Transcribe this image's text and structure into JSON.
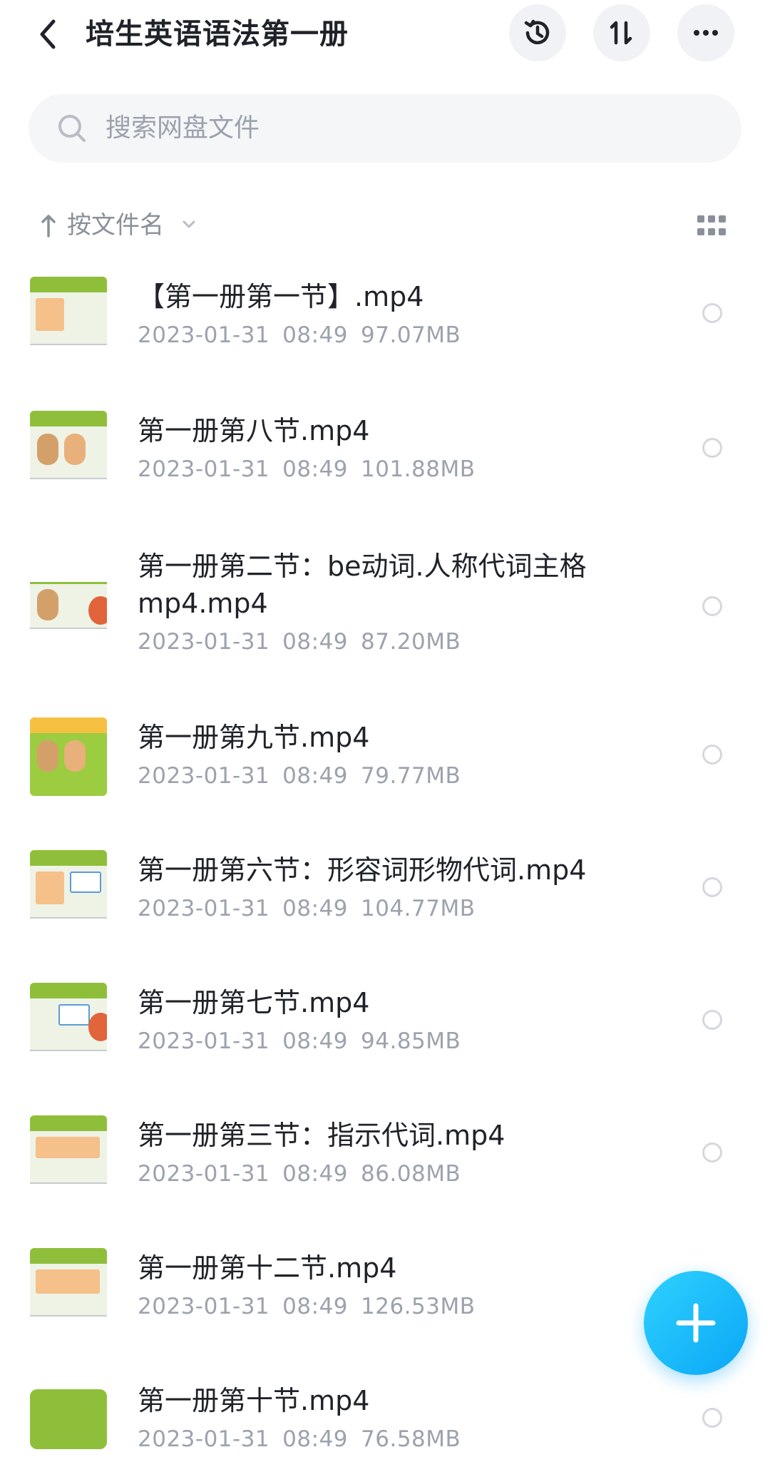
{
  "header": {
    "title": "培生英语语法第一册",
    "back_icon": "chevron-left-icon",
    "actions": [
      "history-icon",
      "sort-order-icon",
      "more-icon"
    ]
  },
  "search": {
    "placeholder": "搜索网盘文件"
  },
  "sort": {
    "label": "按文件名",
    "direction_icon": "arrow-up-icon",
    "view_icon": "grid-view-icon"
  },
  "files": [
    {
      "name": "【第一册第一节】.mp4",
      "name_line2": "",
      "date": "2023-01-31",
      "time": "08:49",
      "size": "97.07MB"
    },
    {
      "name": "第一册第八节.mp4",
      "name_line2": "",
      "date": "2023-01-31",
      "time": "08:49",
      "size": "101.88MB"
    },
    {
      "name": "第一册第二节：be动词.人称代词主格",
      "name_line2": "mp4.mp4",
      "date": "2023-01-31",
      "time": "08:49",
      "size": "87.20MB"
    },
    {
      "name": "第一册第九节.mp4",
      "name_line2": "",
      "date": "2023-01-31",
      "time": "08:49",
      "size": "79.77MB"
    },
    {
      "name": "第一册第六节：形容词形物代词.mp4",
      "name_line2": "",
      "date": "2023-01-31",
      "time": "08:49",
      "size": "104.77MB"
    },
    {
      "name": "第一册第七节.mp4",
      "name_line2": "",
      "date": "2023-01-31",
      "time": "08:49",
      "size": "94.85MB"
    },
    {
      "name": "第一册第三节：指示代词.mp4",
      "name_line2": "",
      "date": "2023-01-31",
      "time": "08:49",
      "size": "86.08MB"
    },
    {
      "name": "第一册第十二节.mp4",
      "name_line2": "",
      "date": "2023-01-31",
      "time": "08:49",
      "size": "126.53MB"
    },
    {
      "name": "第一册第十节.mp4",
      "name_line2": "",
      "date": "2023-01-31",
      "time": "08:49",
      "size": "76.58MB"
    }
  ],
  "fab": {
    "icon": "plus-icon"
  },
  "colors": {
    "accent": "#0aa6f5",
    "text": "#1f2329",
    "muted": "#9ca2ad"
  }
}
